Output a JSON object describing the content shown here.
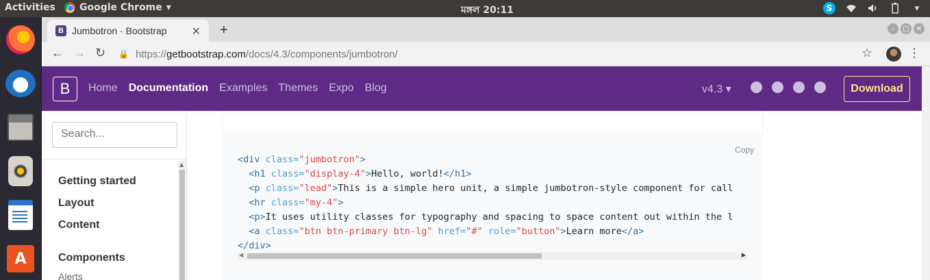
{
  "system": {
    "activities": "Activities",
    "app_name": "Google Chrome",
    "clock": "মঙ্গল 20:11"
  },
  "dock": {
    "items": [
      "firefox-icon",
      "thunderbird-icon",
      "files-icon",
      "rhythmbox-icon",
      "libreoffice-writer-icon",
      "ubuntu-software-icon"
    ]
  },
  "browser": {
    "tab_title": "Jumbotron · Bootstrap",
    "tab_favicon": "B",
    "new_tab": "+",
    "url_scheme": "https://",
    "url_host": "getbootstrap.com",
    "url_path": "/docs/4.3/components/jumbotron/"
  },
  "navbar": {
    "brand": "B",
    "links": [
      "Home",
      "Documentation",
      "Examples",
      "Themes",
      "Expo",
      "Blog"
    ],
    "active_link": "Documentation",
    "version": "v4.3 ▾",
    "download": "Download",
    "colors": {
      "background": "#5f2a86",
      "download": "#ffe484"
    }
  },
  "sidebar": {
    "search_placeholder": "Search...",
    "items": [
      "Getting started",
      "Layout",
      "Content",
      "Components"
    ],
    "sub_items": [
      "Alerts"
    ]
  },
  "code_block": {
    "copy_label": "Copy",
    "lines": [
      [
        {
          "t": "tag",
          "v": "<div "
        },
        {
          "t": "attr",
          "v": "class="
        },
        {
          "t": "val",
          "v": "\"jumbotron\""
        },
        {
          "t": "tag",
          "v": ">"
        }
      ],
      [
        {
          "t": "txt",
          "v": "  "
        },
        {
          "t": "tag",
          "v": "<h1 "
        },
        {
          "t": "attr",
          "v": "class="
        },
        {
          "t": "val",
          "v": "\"display-4\""
        },
        {
          "t": "tag",
          "v": ">"
        },
        {
          "t": "txt",
          "v": "Hello, world!"
        },
        {
          "t": "tag",
          "v": "</h1>"
        }
      ],
      [
        {
          "t": "txt",
          "v": "  "
        },
        {
          "t": "tag",
          "v": "<p "
        },
        {
          "t": "attr",
          "v": "class="
        },
        {
          "t": "val",
          "v": "\"lead\""
        },
        {
          "t": "tag",
          "v": ">"
        },
        {
          "t": "txt",
          "v": "This is a simple hero unit, a simple jumbotron-style component for call"
        }
      ],
      [
        {
          "t": "txt",
          "v": "  "
        },
        {
          "t": "tag",
          "v": "<hr "
        },
        {
          "t": "attr",
          "v": "class="
        },
        {
          "t": "val",
          "v": "\"my-4\""
        },
        {
          "t": "tag",
          "v": ">"
        }
      ],
      [
        {
          "t": "txt",
          "v": "  "
        },
        {
          "t": "tag",
          "v": "<p>"
        },
        {
          "t": "txt",
          "v": "It uses utility classes for typography and spacing to space content out within the l"
        }
      ],
      [
        {
          "t": "txt",
          "v": "  "
        },
        {
          "t": "tag",
          "v": "<a "
        },
        {
          "t": "attr",
          "v": "class="
        },
        {
          "t": "val",
          "v": "\"btn btn-primary btn-lg\""
        },
        {
          "t": "txt",
          "v": " "
        },
        {
          "t": "attr",
          "v": "href="
        },
        {
          "t": "val",
          "v": "\"#\""
        },
        {
          "t": "txt",
          "v": " "
        },
        {
          "t": "attr",
          "v": "role="
        },
        {
          "t": "val",
          "v": "\"button\""
        },
        {
          "t": "tag",
          "v": ">"
        },
        {
          "t": "txt",
          "v": "Learn more"
        },
        {
          "t": "tag",
          "v": "</a>"
        }
      ],
      [
        {
          "t": "tag",
          "v": "</div>"
        }
      ]
    ]
  }
}
